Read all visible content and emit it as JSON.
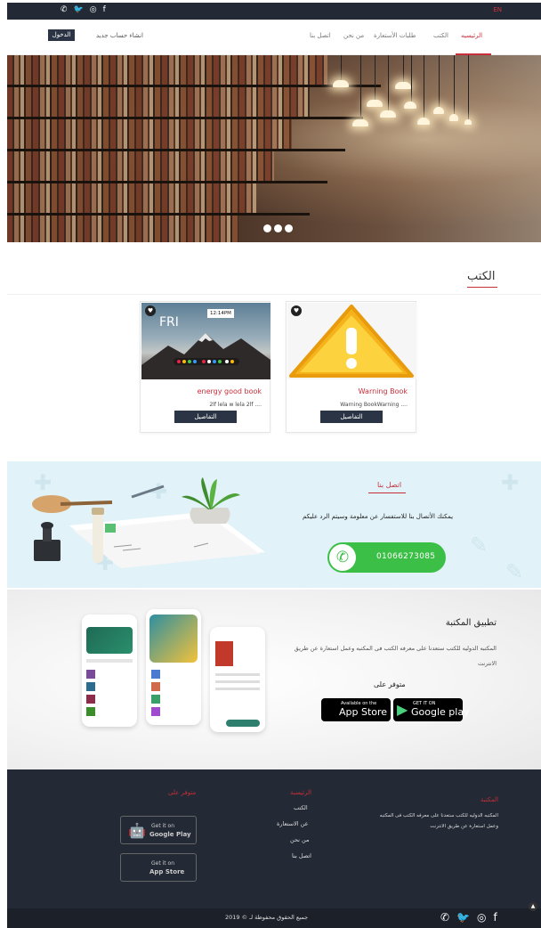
{
  "topbar": {
    "social_icons": [
      "whatsapp-icon",
      "twitter-icon",
      "instagram-icon",
      "facebook-icon"
    ],
    "lang_en": "EN"
  },
  "nav": {
    "items": [
      "الرئيسيه",
      "الكتب",
      "طلبات الأستعارة",
      "من نحن",
      "اتصل بنا"
    ],
    "active": "الرئيسيه",
    "register": "انشاء حساب جديد",
    "login": "الدخول"
  },
  "hero": {
    "slide_count": 3
  },
  "books": {
    "title": "الكتب",
    "cards": [
      {
        "title": "Warning Book",
        "desc": "Warning BookWarning ....",
        "details": "التفاصيل",
        "clock": ""
      },
      {
        "title": "energy good book",
        "desc": "2lf lela w lela 2lf ....",
        "details": "التفاصيل",
        "clock": "12:14PM"
      }
    ]
  },
  "contact": {
    "title": "اتصل بنا",
    "text": "يمكنك الأتصال بنا للاستفسار عن معلومة وسيتم الرد عليكم",
    "phone": "01066273085"
  },
  "app": {
    "title": "تطبيق المكتبة",
    "desc": "المكتبه الدوليه للكتب ستعدنا على معرفه الكتب فى المكتبه وعمل استعارة عن طريق الانترنت",
    "available_on": "متوفر على",
    "app_store": {
      "top": "Available on the",
      "bottom": "App Store"
    },
    "google_play": {
      "top": "GET IT ON",
      "bottom": "Google play"
    }
  },
  "footer": {
    "library_title": "المكتبة",
    "library_text": "المكتبه الدوليه للكتب ستعدنا على معرفه الكتب فى المكتبه وعمل استعارة عن طريق الانترنت",
    "links_title": "الرئيسية",
    "links": [
      "الكتب",
      "عن الاستعارة",
      "من نحن",
      "اتصل بنا"
    ],
    "available_title": "متوفر على",
    "google_play": {
      "top": "Get it on",
      "bottom": "Google Play"
    },
    "app_store": {
      "top": "Get it on",
      "bottom": "App Store"
    }
  },
  "bottombar": {
    "copyright": "جميع الحقوق محفوظة لـ",
    "brand": "",
    "year": "2019 ©"
  },
  "colors": {
    "accent": "#c62f3a",
    "dark": "#232935",
    "whatsapp": "#3cbf46",
    "contact_bg": "#e1f2f8"
  }
}
